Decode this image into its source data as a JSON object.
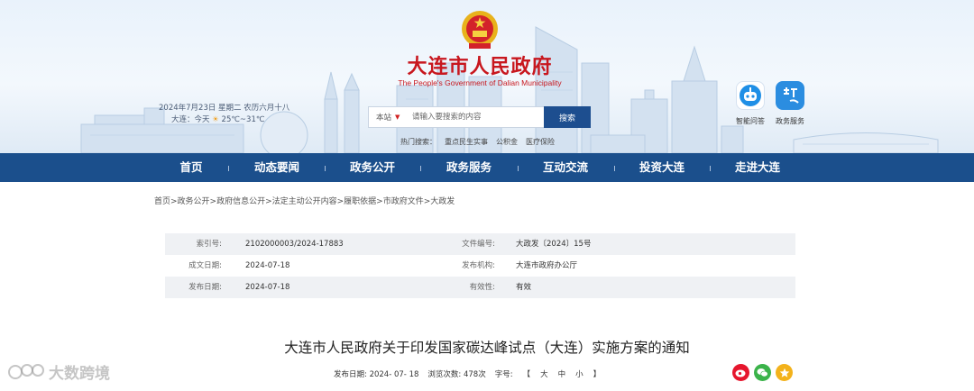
{
  "header": {
    "title": "大连市人民政府",
    "subtitle": "The People's Government of Dalian Municipality",
    "date": "2024年7月23日 星期二 农历六月十八",
    "weather_city": "大连：今天",
    "weather_temp": "25℃~31℃",
    "search": {
      "scope": "本站",
      "placeholder": "请输入要搜索的内容",
      "button": "搜索"
    },
    "hot": {
      "label": "热门搜索：",
      "items": [
        "重点民生实事",
        "公积金",
        "医疗保险"
      ]
    },
    "apps": [
      {
        "label": "智能问答",
        "icon": "robot-icon"
      },
      {
        "label": "政务服务",
        "icon": "service-icon"
      }
    ]
  },
  "nav": [
    "首页",
    "动态要闻",
    "政务公开",
    "政务服务",
    "互动交流",
    "投资大连",
    "走进大连"
  ],
  "breadcrumb": "首页>政务公开>政府信息公开>法定主动公开内容>履职依据>市政府文件>大政发",
  "info": {
    "index_label": "索引号:",
    "index_value": "2102000003/2024-17883",
    "docno_label": "文件编号:",
    "docno_value": "大政发〔2024〕15号",
    "created_label": "成文日期:",
    "created_value": "2024-07-18",
    "issuer_label": "发布机构:",
    "issuer_value": "大连市政府办公厅",
    "published_label": "发布日期:",
    "published_value": "2024-07-18",
    "validity_label": "有效性:",
    "validity_value": "有效"
  },
  "article": {
    "title": "大连市人民政府关于印发国家碳达峰试点（大连）实施方案的通知",
    "publish_label": "发布日期:",
    "publish_value": "2024- 07- 18",
    "views_label": "浏览次数:",
    "views_value": "478次",
    "font_label": "字号:",
    "font_open": "【",
    "font_large": "大",
    "font_medium": "中",
    "font_small": "小",
    "font_close": "】"
  },
  "watermark": "大数跨境",
  "colors": {
    "nav_bg": "#1b4f8c",
    "title_red": "#c8171e",
    "search_btn": "#1d4e8f"
  }
}
